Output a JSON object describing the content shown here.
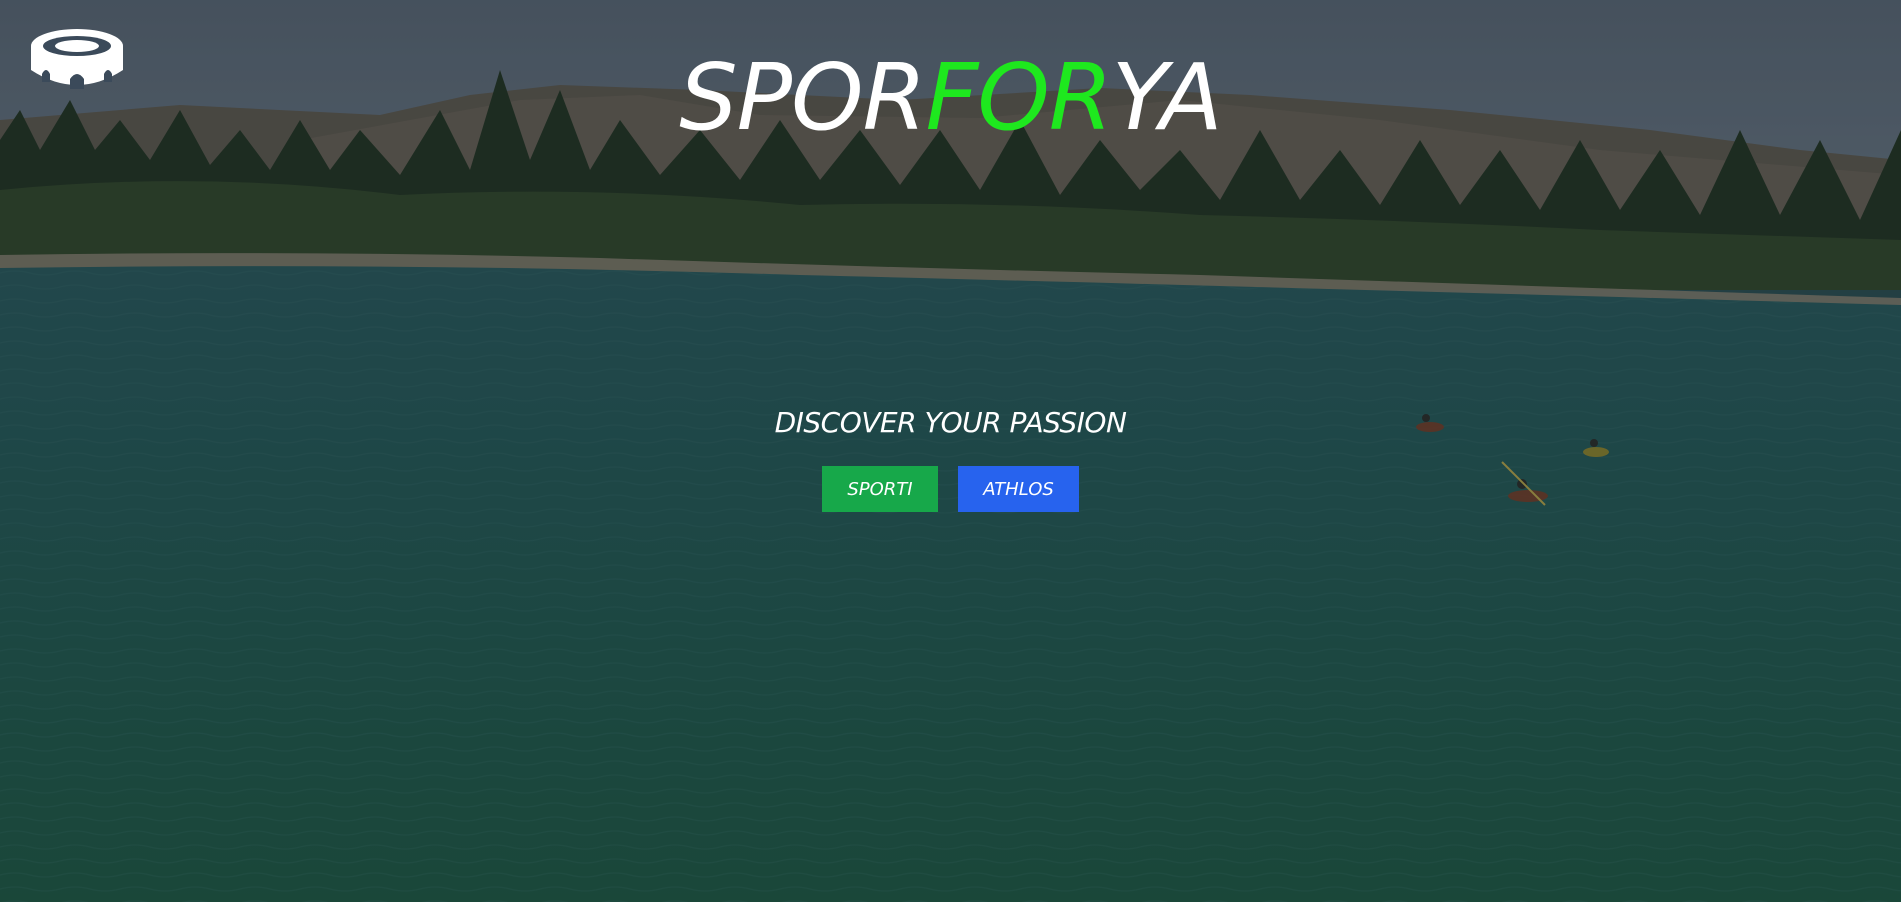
{
  "brand": {
    "part1": "SPOR",
    "part2": "FOR",
    "part3": "YA"
  },
  "tagline": "DISCOVER YOUR PASSION",
  "buttons": {
    "sporti": "SPORTI",
    "athlos": "ATHLOS"
  },
  "colors": {
    "accent_green": "#1ee81e",
    "sporti_button": "#17a84a",
    "athlos_button": "#2763ee"
  },
  "icons": {
    "logo": "stadium-icon"
  }
}
